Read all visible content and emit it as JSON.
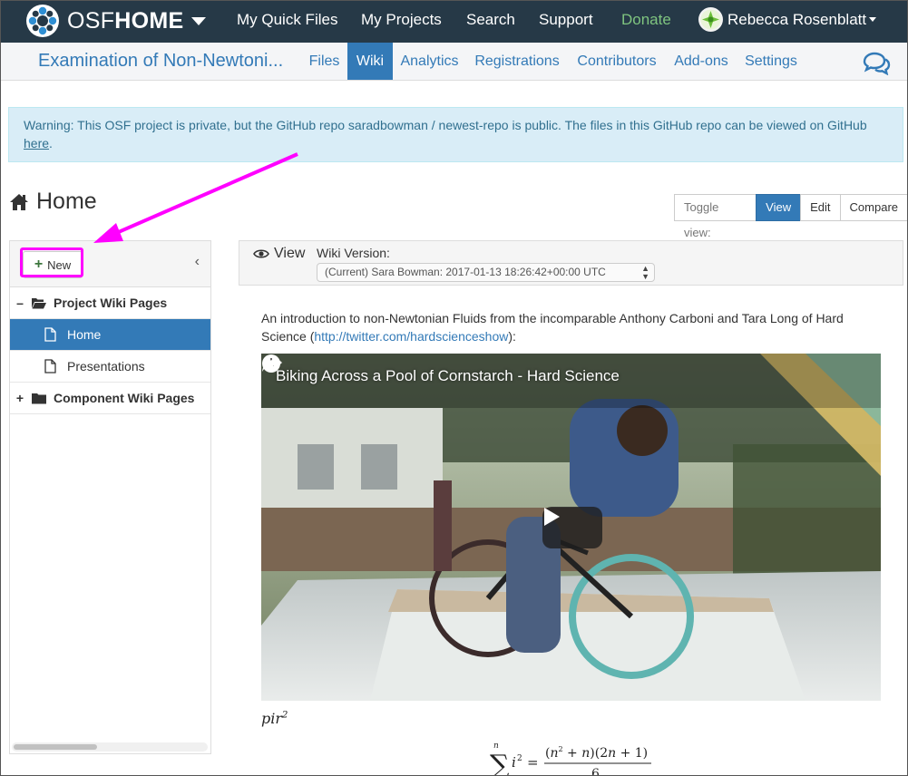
{
  "navbar": {
    "brand_light": "OSF",
    "brand_bold": "HOME",
    "links": [
      "My Quick Files",
      "My Projects",
      "Search",
      "Support",
      "Donate"
    ],
    "user_name": "Rebecca Rosenblatt"
  },
  "project_nav": {
    "title": "Examination of Non-Newtoni...",
    "tabs": [
      "Files",
      "Wiki",
      "Analytics",
      "Registrations",
      "Contributors",
      "Add-ons",
      "Settings"
    ],
    "active_tab": "Wiki"
  },
  "alert": {
    "text": "Warning: This OSF project is private, but the GitHub repo saradbowman / newest-repo is public. The files in this GitHub repo can be viewed on GitHub ",
    "link": "here",
    "suffix": "."
  },
  "page": {
    "title": "Home"
  },
  "toggle_view": {
    "label": "Toggle view:",
    "buttons": [
      "View",
      "Edit",
      "Compare"
    ],
    "active": "View"
  },
  "sidebar": {
    "new_label": "New",
    "collapse_glyph": "‹",
    "project_group": "Project Wiki Pages",
    "pages": [
      "Home",
      "Presentations"
    ],
    "active_page": "Home",
    "component_group": "Component Wiki Pages"
  },
  "viewer": {
    "view_label": "View",
    "version_label": "Wiki Version:",
    "version_value": "(Current) Sara Bowman: 2017-01-13 18:26:42+00:00 UTC"
  },
  "content": {
    "intro_text": "An introduction to non-Newtonian Fluids from the incomparable Anthony Carboni and Tara Long of Hard Science (",
    "intro_link": "http://twitter.com/hardscienceshow",
    "intro_suffix": "):",
    "video_title": "Biking Across a Pool of Cornstarch - Hard Science",
    "math_pir": "pir",
    "math_pir_exp": "2"
  },
  "colors": {
    "navbar_bg": "#263947",
    "accent": "#337ab7",
    "donate": "#7fc47f",
    "annotation": "#ff00ff",
    "alert_bg": "#d9edf7"
  }
}
